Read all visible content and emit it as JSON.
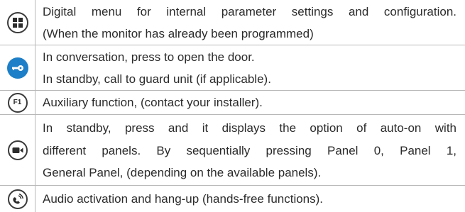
{
  "rows": [
    {
      "icon": "menu-grid-icon",
      "lines": [
        "Digital menu for internal parameter settings and configuration.",
        "(When the monitor has already been programmed)"
      ]
    },
    {
      "icon": "key-icon",
      "lines": [
        "In conversation, press to open the door.",
        "In standby, call to guard unit (if applicable)."
      ]
    },
    {
      "icon": "f1-icon",
      "icon_label": "F1",
      "lines": [
        "Auxiliary function, (contact your installer)."
      ]
    },
    {
      "icon": "camera-icon",
      "lines": [
        "In standby, press and it displays the option of auto-on with",
        "different panels. By sequentially pressing Panel 0, Panel 1,",
        "General Panel, (depending on the available panels)."
      ]
    },
    {
      "icon": "hands-free-icon",
      "lines": [
        "Audio activation and hang-up (hands-free functions)."
      ]
    }
  ],
  "colors": {
    "text": "#2b2b2b",
    "rule": "#b8b8b8",
    "accent_blue": "#1d7fc7"
  }
}
